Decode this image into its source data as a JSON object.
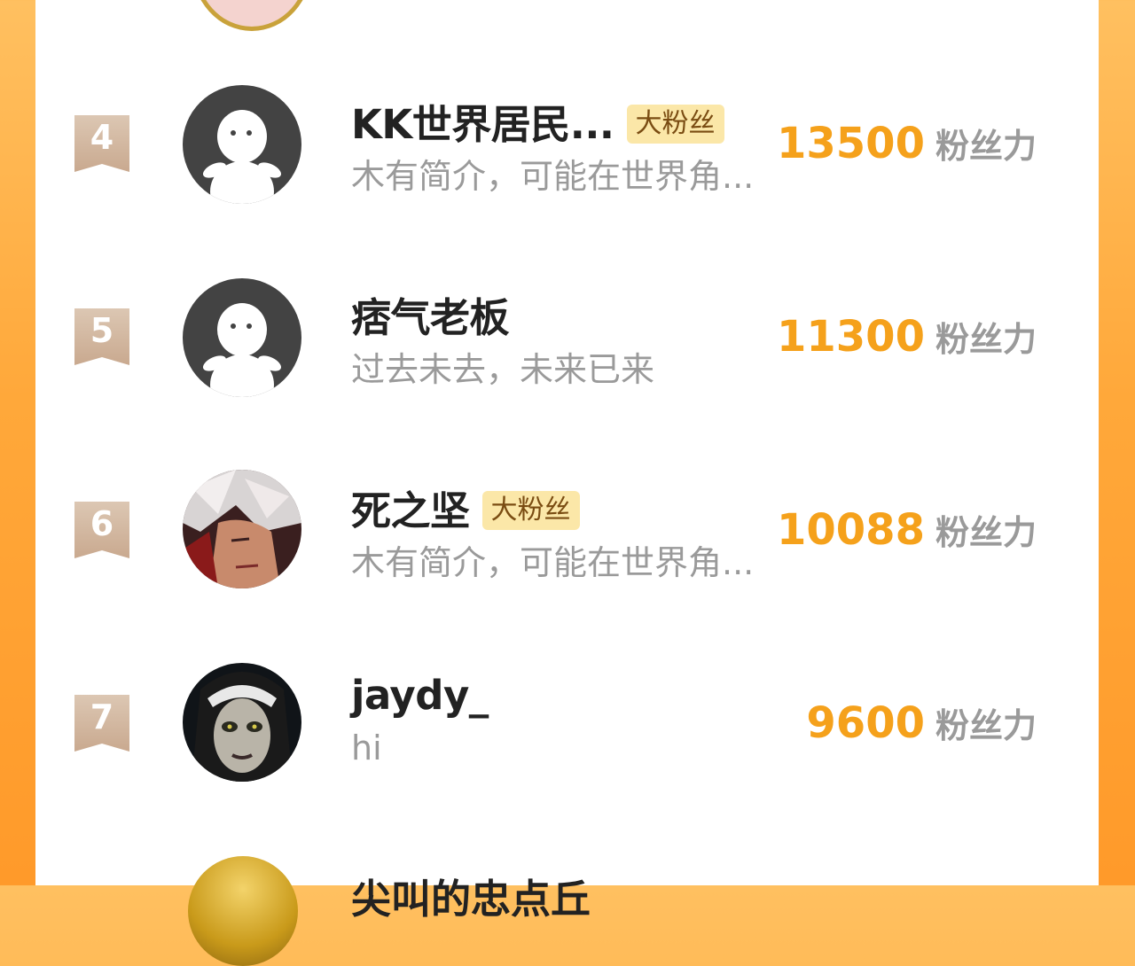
{
  "leaderboard": {
    "unit_label": "粉丝力",
    "badge_label": "大粉丝",
    "rows": [
      {
        "rank": "4",
        "name": "KK世界居民...",
        "badge": "大粉丝",
        "bio": "木有简介，可能在世界角...",
        "score": "13500",
        "avatar": "default-avatar-icon"
      },
      {
        "rank": "5",
        "name": "痞气老板",
        "badge": "",
        "bio": "过去未去，未来已来",
        "score": "11300",
        "avatar": "default-avatar-icon"
      },
      {
        "rank": "6",
        "name": "死之坚",
        "badge": "大粉丝",
        "bio": "木有简介，可能在世界角...",
        "score": "10088",
        "avatar": "anime-character-avatar"
      },
      {
        "rank": "7",
        "name": "jaydy_",
        "badge": "",
        "bio": "hi",
        "score": "9600",
        "avatar": "nun-horror-avatar"
      }
    ],
    "next_row_name_partial": "尖叫的忠点丘"
  },
  "colors": {
    "score": "#f5a11b",
    "rank_ribbon": "#c9a98f",
    "badge_bg": "#fbe7a8",
    "background_gradient": "#ffa83a"
  }
}
